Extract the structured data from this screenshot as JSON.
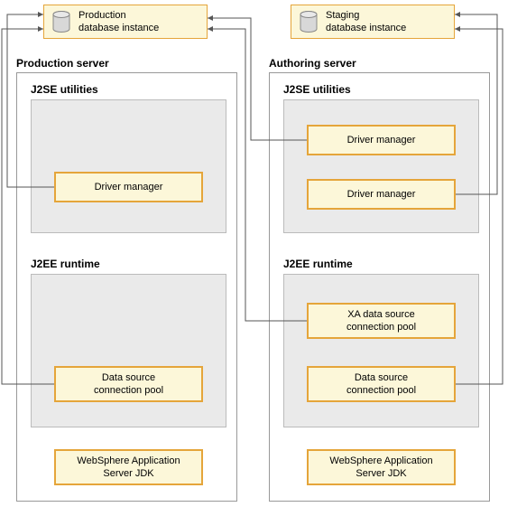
{
  "db_production": {
    "label": "Production\ndatabase instance"
  },
  "db_staging": {
    "label": "Staging\ndatabase instance"
  },
  "production_server": {
    "title": "Production server",
    "j2se_title": "J2SE utilities",
    "driver_manager": "Driver manager",
    "j2ee_title": "J2EE runtime",
    "data_source_pool": "Data source\nconnection pool",
    "was_jdk": "WebSphere Application\nServer JDK"
  },
  "authoring_server": {
    "title": "Authoring server",
    "j2se_title": "J2SE utilities",
    "driver_manager_1": "Driver manager",
    "driver_manager_2": "Driver manager",
    "j2ee_title": "J2EE runtime",
    "xa_pool": "XA data source\nconnection pool",
    "data_source_pool": "Data source\nconnection pool",
    "was_jdk": "WebSphere Application\nServer JDK"
  }
}
